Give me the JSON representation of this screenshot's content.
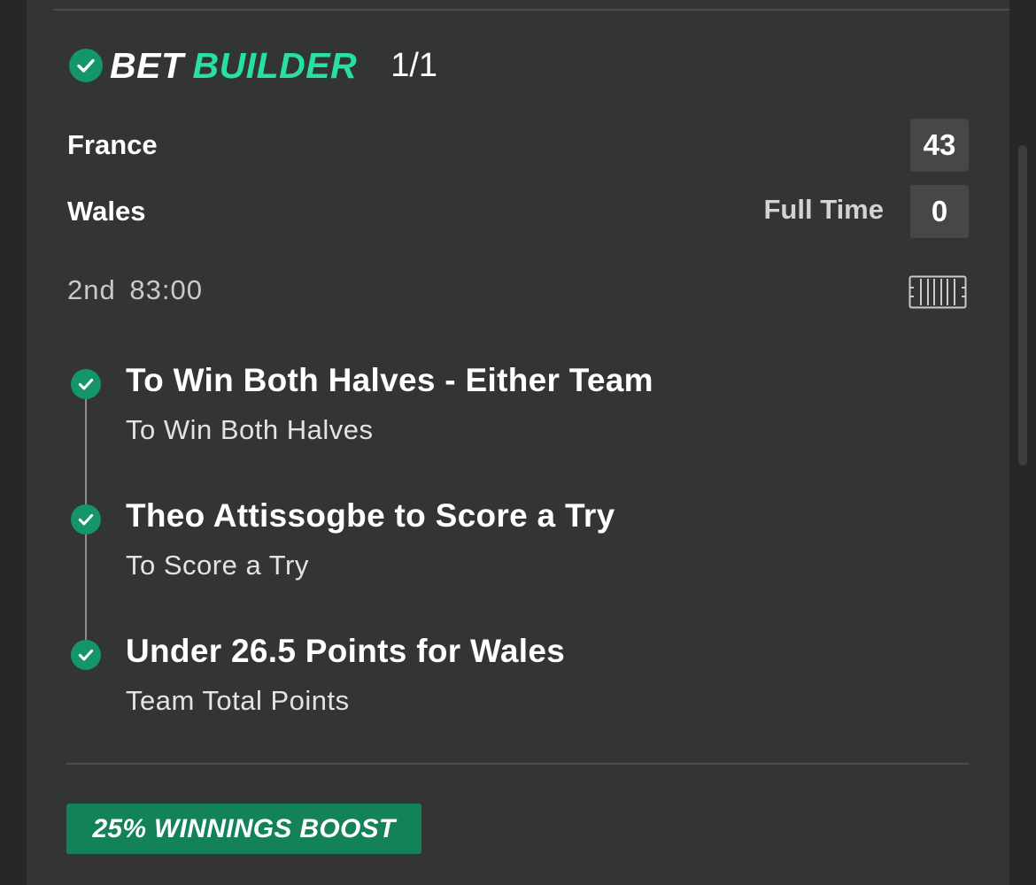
{
  "bet_builder": {
    "title_part1": "BET",
    "title_part2": "BUILDER",
    "count": "1/1",
    "accent_color": "#28e0a6",
    "check_color": "#14966a"
  },
  "match": {
    "home_team": "France",
    "home_score": "43",
    "away_team": "Wales",
    "away_score": "0",
    "status": "Full Time",
    "period": "2nd",
    "clock": "83:00",
    "pitch_icon": "pitch-icon"
  },
  "selections": [
    {
      "name": "To Win Both Halves - Either Team",
      "market": "To Win Both Halves",
      "icon": "check-circle-icon"
    },
    {
      "name": "Theo Attissogbe to Score a Try",
      "market": "To Score a Try",
      "icon": "check-circle-icon"
    },
    {
      "name": "Under 26.5 Points for Wales",
      "market": "Team Total Points",
      "icon": "check-circle-icon"
    }
  ],
  "promo": {
    "label": "25% WINNINGS BOOST",
    "color": "#148258"
  }
}
